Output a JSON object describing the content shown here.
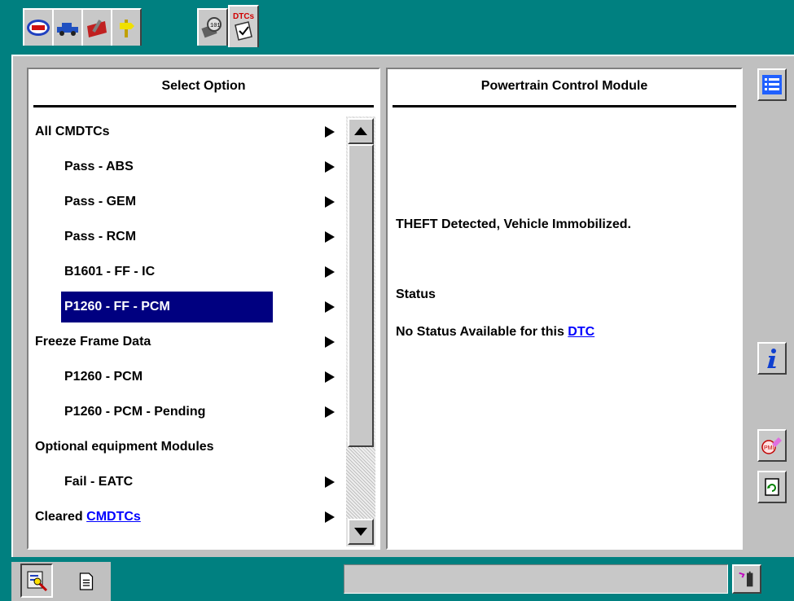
{
  "toolbar": {
    "tabs": [
      {
        "icon": "wds-logo-icon"
      },
      {
        "icon": "vehicle-icon"
      },
      {
        "icon": "toolbox-icon"
      },
      {
        "icon": "signpost-icon"
      },
      {
        "icon": "magnifier-module-icon"
      },
      {
        "icon": "dtc-clipboard-icon",
        "label": "DTCs"
      }
    ]
  },
  "left_panel": {
    "title": "Select Option",
    "items": [
      {
        "label": "All CMDTCs",
        "indent": 0,
        "arrow": true
      },
      {
        "label": "Pass - ABS",
        "indent": 1,
        "arrow": true
      },
      {
        "label": "Pass - GEM",
        "indent": 1,
        "arrow": true
      },
      {
        "label": "Pass - RCM",
        "indent": 1,
        "arrow": true
      },
      {
        "label": "B1601 - FF - IC",
        "indent": 1,
        "arrow": true
      },
      {
        "label": "P1260 - FF - PCM",
        "indent": 1,
        "arrow": true,
        "selected": true
      },
      {
        "label": "Freeze Frame Data",
        "indent": 0,
        "arrow": true
      },
      {
        "label": "P1260 - PCM",
        "indent": 1,
        "arrow": true
      },
      {
        "label": "P1260 - PCM - Pending",
        "indent": 1,
        "arrow": true
      },
      {
        "label": "Optional equipment Modules",
        "indent": 0,
        "arrow": false
      },
      {
        "label": "Fail - EATC",
        "indent": 1,
        "arrow": true
      },
      {
        "label_prefix": "Cleared ",
        "label_link": "CMDTCs",
        "indent": 0,
        "arrow": true
      }
    ]
  },
  "right_panel": {
    "title": "Powertrain Control Module",
    "message": "THEFT Detected, Vehicle Immobilized.",
    "status_label": "Status",
    "status_text": "No Status Available for this ",
    "status_link": "DTC"
  },
  "side_buttons": [
    "list-icon",
    "info-icon",
    "pmi-eraser-icon",
    "refresh-page-icon"
  ],
  "bottom_bar": {
    "buttons": [
      "module-search-icon",
      "document-icon",
      "signal-check-icon"
    ],
    "status_text": ""
  },
  "colors": {
    "background": "#008080",
    "panel": "#c0c0c0",
    "selection": "#000080",
    "link": "#0000ff"
  }
}
